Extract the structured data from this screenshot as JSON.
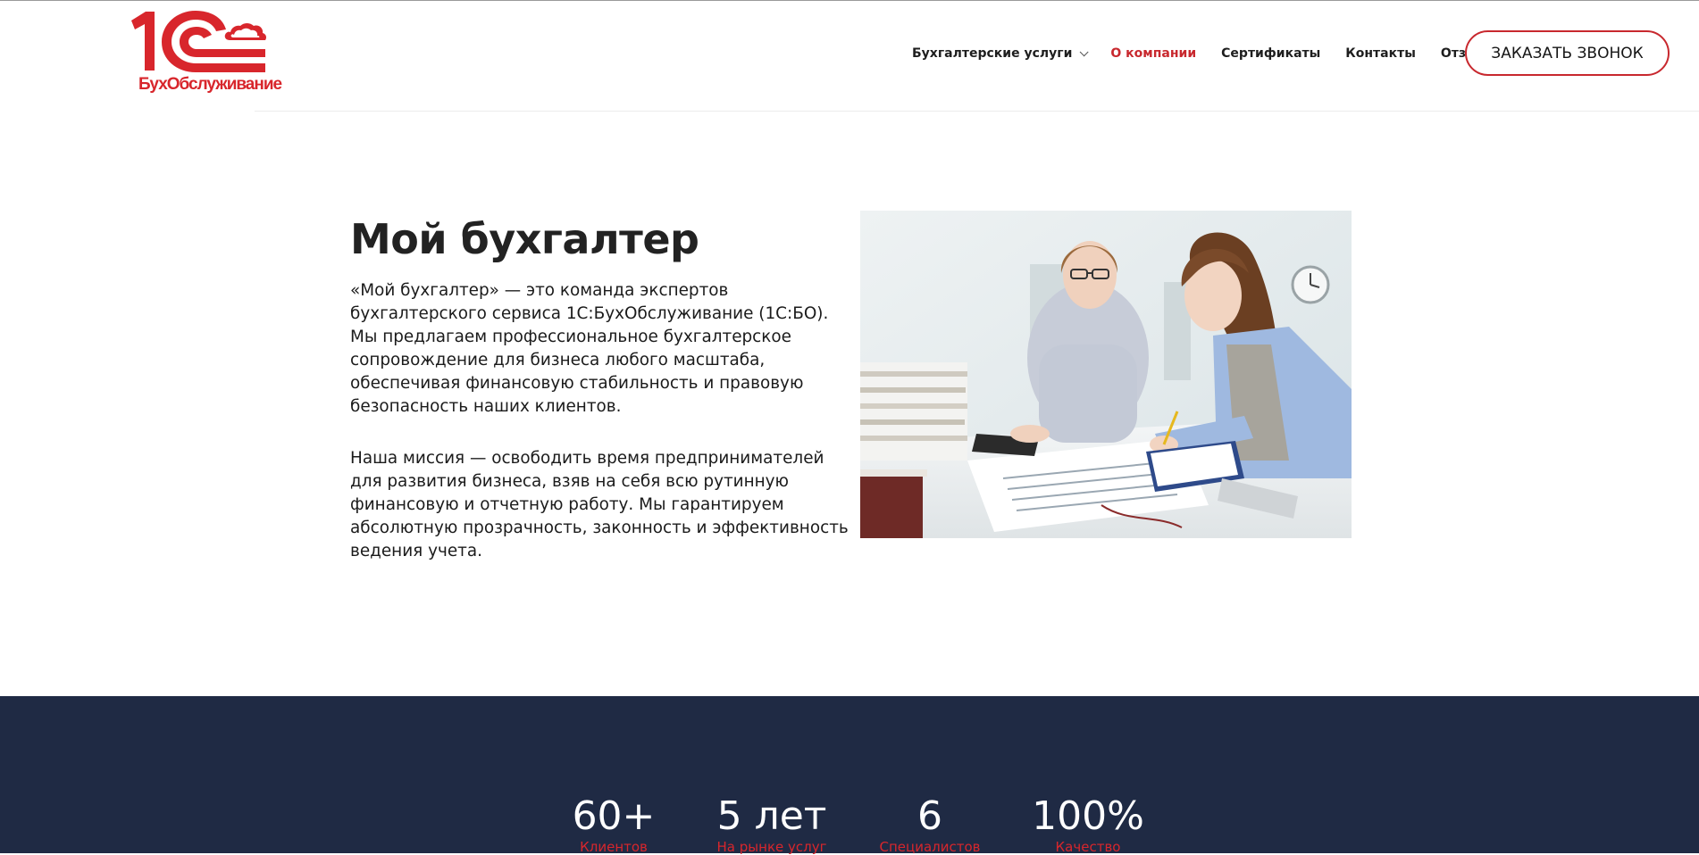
{
  "header": {
    "logo": {
      "mark": "1C",
      "text": "БухОбслуживание",
      "brand_color": "#d8262c"
    },
    "nav": [
      {
        "label": "Бухгалтерские услуги",
        "has_dropdown": true,
        "active": false
      },
      {
        "label": "О компании",
        "has_dropdown": false,
        "active": true
      },
      {
        "label": "Сертификаты",
        "has_dropdown": false,
        "active": false
      },
      {
        "label": "Контакты",
        "has_dropdown": false,
        "active": false
      },
      {
        "label": "Отзывы",
        "has_dropdown": false,
        "active": false
      }
    ],
    "call_button_label": "ЗАКАЗАТЬ ЗВОНОК",
    "active_color": "#c8282e"
  },
  "about": {
    "title": "Мой бухгалтер",
    "paragraph1": "«Мой бухгалтер» — это команда экспертов бухгалтерского сервиса 1С:БухОбслуживание (1С:БО). Мы предлагаем профессиональное бухгалтерское сопровождение для бизнеса любого масштаба, обеспечивая финансовую стабильность и правовую безопасность наших клиентов.",
    "paragraph2": "Наша миссия — освободить время предпринимателей для развития бизнеса, взяв на себя всю рутинную финансовую и отчетную работу. Мы гарантируем абсолютную прозрачность, законность и эффективность ведения учета."
  },
  "stats": {
    "background": "#1f2a44",
    "items": [
      {
        "value": "60+",
        "label": "Клиентов"
      },
      {
        "value": "5 лет",
        "label": "На рынке услуг"
      },
      {
        "value": "6",
        "label": "Специалистов"
      },
      {
        "value": "100%",
        "label": "Качество"
      }
    ]
  }
}
